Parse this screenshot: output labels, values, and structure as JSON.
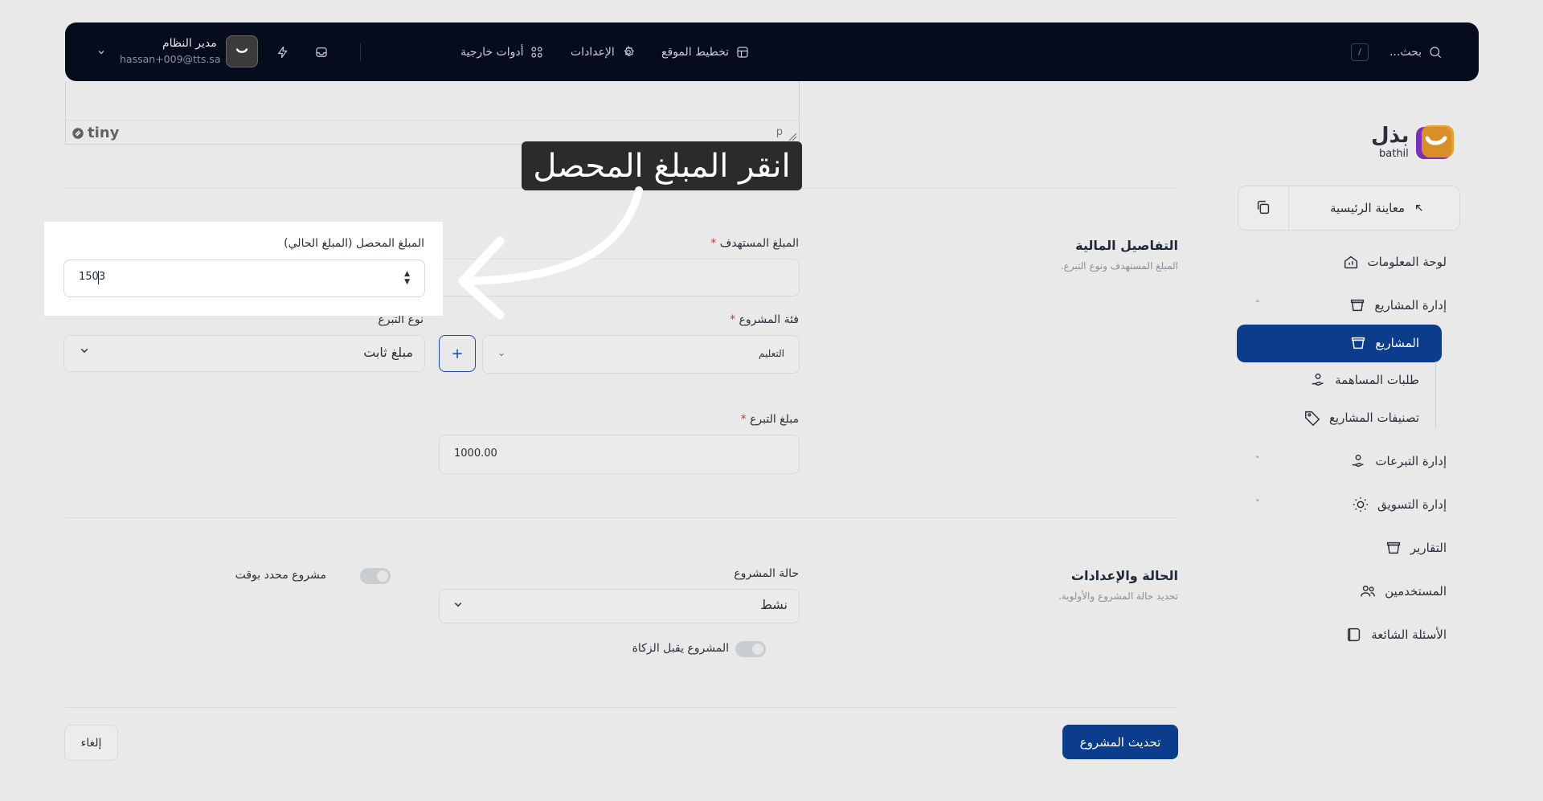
{
  "topbar": {
    "search_placeholder": "بحث...",
    "search_shortcut": "/",
    "nav_site_layout": "تخطيط الموقع",
    "nav_settings": "الإعدادات",
    "nav_external_tools": "أدوات خارجية",
    "user_name": "مدير النظام",
    "user_email": "hassan+009@tts.sa"
  },
  "editor": {
    "brand": "tiny",
    "path": "p"
  },
  "sidebar": {
    "logo_ar": "بذل",
    "logo_en": "bathil",
    "preview_label": "معاينة الرئيسية",
    "items": [
      {
        "label": "لوحة المعلومات"
      },
      {
        "label": "إدارة المشاريع"
      },
      {
        "label": "المشاريع"
      },
      {
        "label": "طلبات المساهمة"
      },
      {
        "label": "تصنيفات المشاريع"
      },
      {
        "label": "إدارة التبرعات"
      },
      {
        "label": "إدارة التسويق"
      },
      {
        "label": "التقارير"
      },
      {
        "label": "المستخدمين"
      },
      {
        "label": "الأسئلة الشائعة"
      }
    ]
  },
  "financial": {
    "title": "التفاصيل المالية",
    "subtitle": "المبلغ المستهدف ونوع التبرع.",
    "target_label": "المبلغ المستهدف",
    "collected_label": "المبلغ المحصل (المبلغ الحالي)",
    "collected_value": "1503",
    "category_label": "فئة المشروع",
    "category_value": "التعليم",
    "add_button": "+",
    "donation_type_label": "نوع التبرع",
    "donation_type_value": "مبلغ ثابت",
    "donation_amount_label": "مبلغ التبرع",
    "donation_amount_value": "1000.00",
    "required_mark": "*"
  },
  "status": {
    "title": "الحالة والإعدادات",
    "subtitle": "تحديد حالة المشروع والأولوية.",
    "project_status_label": "حالة المشروع",
    "project_status_value": "نشط",
    "temporary_label": "مشروع محدد بوقت",
    "zakat_label": "المشروع يقبل الزكاة"
  },
  "actions": {
    "update_label": "تحديث المشروع",
    "cancel_label": "إلغاء"
  },
  "callout": {
    "text": "انقر المبلغ المحصل"
  }
}
